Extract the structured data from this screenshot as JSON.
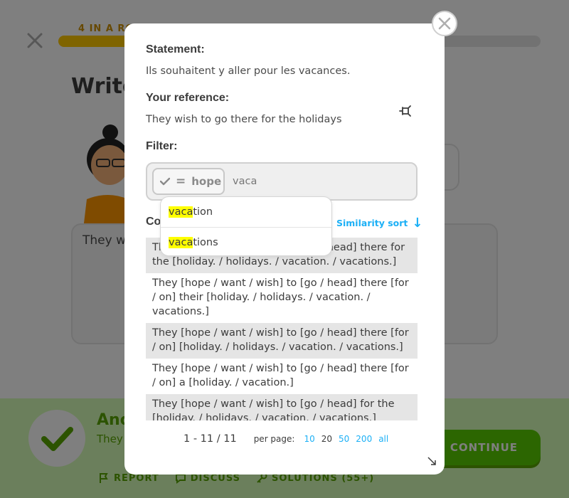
{
  "background": {
    "streak": "4 IN A RO",
    "progress": 0.42,
    "title": "Write",
    "answer_preview": "They wi",
    "feedback_title": "Ano",
    "feedback_text": "They",
    "continue_label": "CONTINUE",
    "actions": [
      {
        "label": "REPORT",
        "icon": "flag-icon"
      },
      {
        "label": "DISCUSS",
        "icon": "chat-icon"
      },
      {
        "label": "SOLUTIONS (55+)",
        "icon": "key-icon"
      }
    ]
  },
  "modal": {
    "statement_label": "Statement:",
    "statement_text": "Ils souhaitent y aller pour les vacances.",
    "reference_label": "Your reference:",
    "reference_text": "They wish to go there for the holidays",
    "filter_label": "Filter:",
    "chip": {
      "operator": "=",
      "word": "hope"
    },
    "filter_input": "vaca",
    "suggestions": [
      {
        "match": "vaca",
        "rest": "tion"
      },
      {
        "match": "vaca",
        "rest": "tions"
      }
    ],
    "solutions_label": "Co",
    "sort_label": "Similarity sort",
    "solutions": [
      "They [hope / want / wish] to [go / head] there for the [holiday. / holidays. / vacation. / vacations.]",
      "They [hope / want / wish] to [go / head] there [for / on] their [holiday. / holidays. / vacation. / vacations.]",
      "They [hope / want / wish] to [go / head] there [for / on] [holiday. / holidays. / vacation. / vacations.]",
      "They [hope / want / wish] to [go / head] there [for / on] a [holiday. / vacation.]",
      "They [hope / want / wish] to [go / head] for the [holiday. / holidays. / vacation. / vacations.]"
    ],
    "pager": {
      "count": "1 - 11 / 11",
      "per_page_label": "per page:",
      "options": [
        "10",
        "20",
        "50",
        "200",
        "all"
      ],
      "selected": "20"
    }
  },
  "colors": {
    "highlight": "#ffff00",
    "link": "#1cb0f6",
    "row_alt": "#e5e5e5"
  }
}
